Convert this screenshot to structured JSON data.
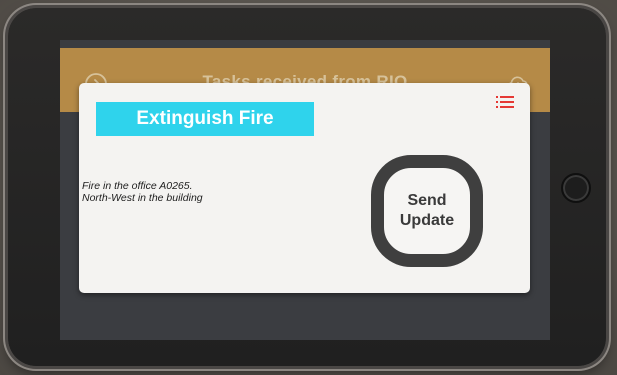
{
  "header": {
    "title": "Tasks received from RIO",
    "left_icon": "login-arrow-icon",
    "right_icon": "cloud-upload-icon",
    "color": "#b58a47"
  },
  "task_card": {
    "title": "Extinguish Fire",
    "title_bg_color": "#2fd3ec",
    "menu_icon": "list-menu-icon",
    "menu_icon_color": "#e53935",
    "description_line1": "Fire in the office A0265.",
    "description_line2": "North-West in the building",
    "send_button_line1": "Send",
    "send_button_line2": "Update"
  }
}
